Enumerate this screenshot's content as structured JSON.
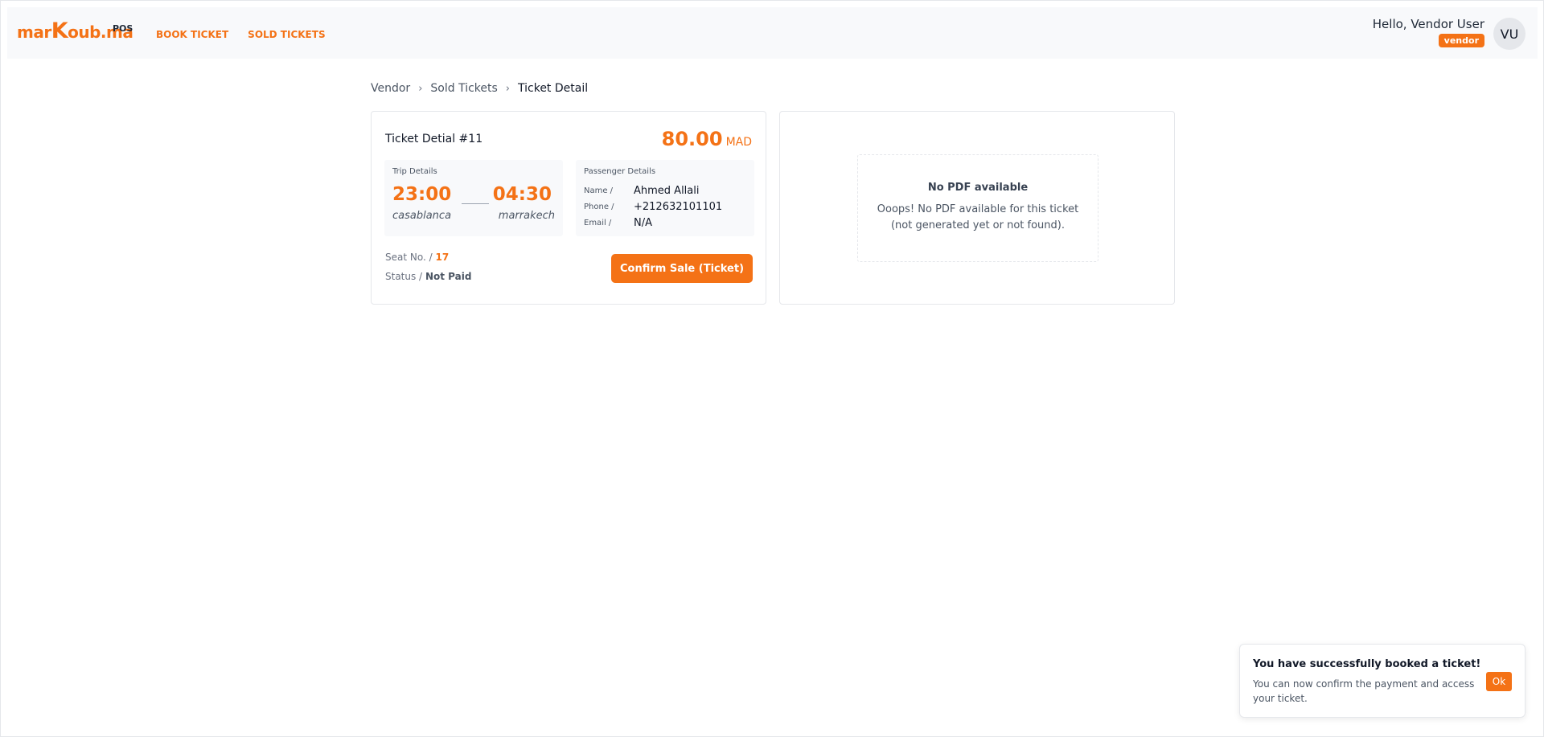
{
  "header": {
    "logo_text_start": "mar",
    "logo_text_k": "K",
    "logo_text_end": "oub.ma",
    "logo_suffix": "POS",
    "nav": [
      {
        "label": "BOOK TICKET"
      },
      {
        "label": "SOLD TICKETS"
      }
    ],
    "greeting": "Hello, Vendor User",
    "role_badge": "vendor",
    "avatar_initials": "VU"
  },
  "breadcrumb": {
    "items": [
      "Vendor",
      "Sold Tickets",
      "Ticket Detail"
    ],
    "separator": "›"
  },
  "ticket": {
    "title": "Ticket Detial #11",
    "price": "80.00",
    "currency": "MAD",
    "trip": {
      "label": "Trip Details",
      "departure_time": "23:00",
      "departure_city": "casablanca",
      "arrival_time": "04:30",
      "arrival_city": "marrakech"
    },
    "passenger": {
      "label": "Passenger Details",
      "name_key": "Name /",
      "name": "Ahmed Allali",
      "phone_key": "Phone /",
      "phone": "+212632101101",
      "email_key": "Email /",
      "email": "N/A"
    },
    "seat_key": "Seat No. /",
    "seat": "17",
    "status_key": "Status /",
    "status": "Not Paid",
    "confirm_label": "Confirm Sale (Ticket)"
  },
  "pdf": {
    "title": "No PDF available",
    "message": "Ooops! No PDF available for this ticket (not generated yet or not found)."
  },
  "toast": {
    "title": "You have successfully booked a ticket!",
    "message": "You can now confirm the payment and access your ticket.",
    "ok_label": "Ok"
  },
  "colors": {
    "accent": "#f47216",
    "header_bg": "#f8f9fb",
    "panel_bg": "#f8f9fb"
  }
}
